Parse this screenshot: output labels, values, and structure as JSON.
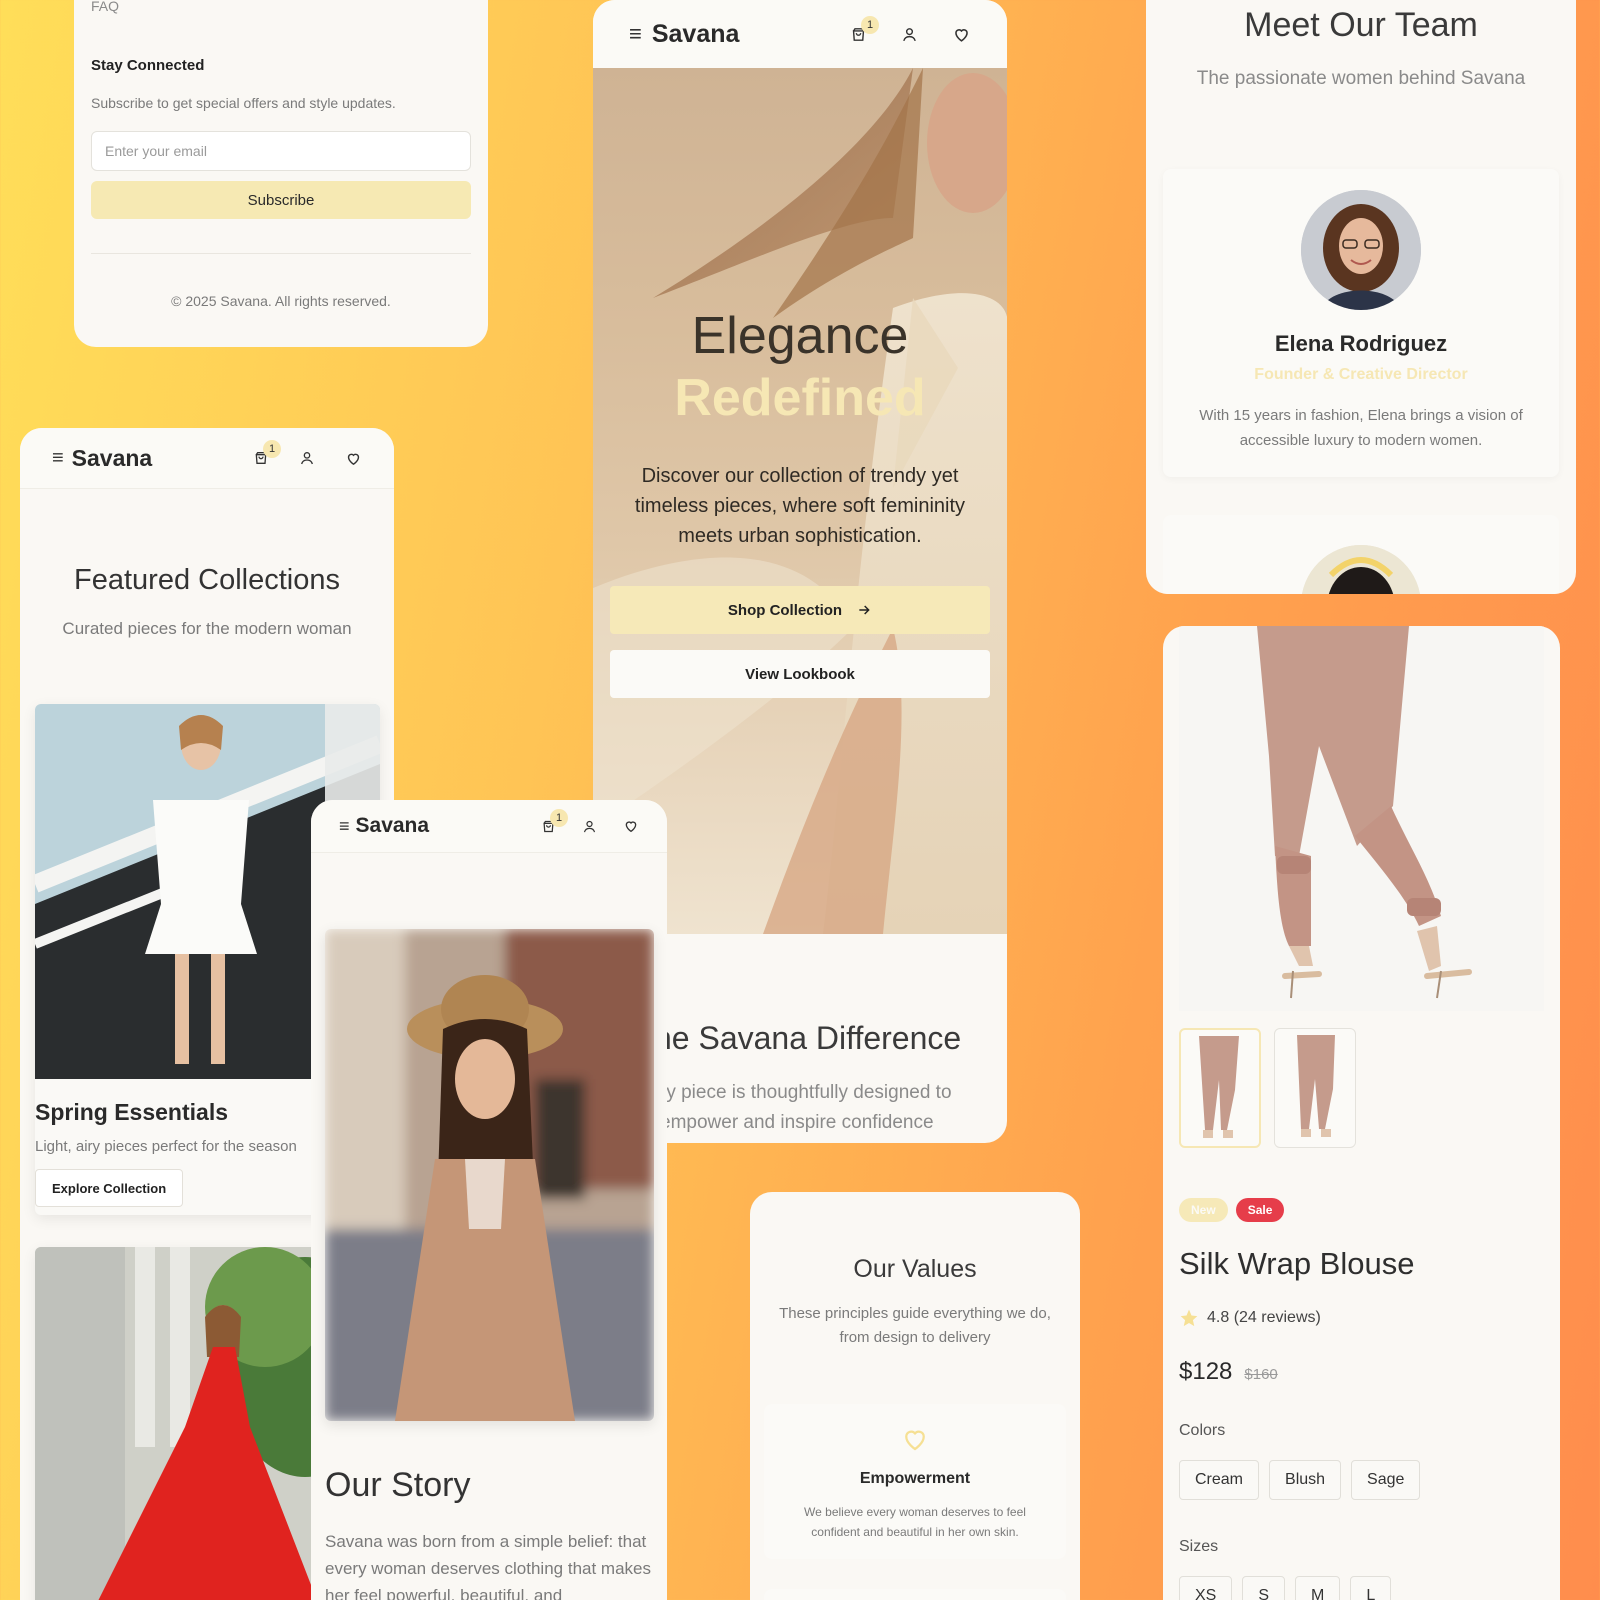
{
  "brand": "Savana",
  "cart_count": "1",
  "icons": {
    "menu": "menu-icon",
    "cart": "shopping-bag-icon",
    "user": "user-icon",
    "wishlist": "heart-icon",
    "arrow": "arrow-right-icon",
    "star": "star-icon",
    "value": "heart-outline-icon"
  },
  "colors": {
    "accent": "#f6e9b8",
    "sale": "#e63d4a",
    "background_from": "#ffde59",
    "background_to": "#ff8d4d"
  },
  "footer": {
    "faq": "FAQ",
    "stay_connected": "Stay Connected",
    "subscribe_text": "Subscribe to get special offers and style updates.",
    "email_placeholder": "Enter your email",
    "subscribe_button": "Subscribe",
    "copyright": "© 2025 Savana. All rights reserved."
  },
  "featured": {
    "title": "Featured Collections",
    "subtitle": "Curated pieces for the modern woman",
    "collections": [
      {
        "name": "Spring Essentials",
        "description": "Light, airy pieces perfect for the season",
        "button": "Explore Collection"
      }
    ]
  },
  "hero": {
    "title_line1": "Elegance",
    "title_line2": "Redefined",
    "description": "Discover our collection of trendy yet timeless pieces, where soft femininity meets urban sophistication.",
    "primary_button": "Shop Collection",
    "secondary_button": "View Lookbook",
    "difference_title": "he Savana Difference",
    "difference_line1": "ry piece is thoughtfully designed to",
    "difference_line2": "empower and inspire confidence"
  },
  "team": {
    "title": "Meet Our Team",
    "subtitle": "The passionate women behind Savana",
    "members": [
      {
        "name": "Elena Rodriguez",
        "role": "Founder & Creative Director",
        "bio": "With 15 years in fashion, Elena brings a vision of accessible luxury to modern women."
      }
    ]
  },
  "product": {
    "badges": {
      "new": "New",
      "sale": "Sale"
    },
    "name": "Silk Wrap Blouse",
    "rating": "4.8 (24 reviews)",
    "price": "$128",
    "original_price": "$160",
    "colors_label": "Colors",
    "colors": [
      "Cream",
      "Blush",
      "Sage"
    ],
    "sizes_label": "Sizes",
    "sizes": [
      "XS",
      "S",
      "M",
      "L"
    ]
  },
  "story": {
    "title": "Our Story",
    "text": "Savana was born from a simple belief: that every woman deserves clothing that makes her feel powerful, beautiful, and"
  },
  "values": {
    "title": "Our Values",
    "subtitle": "These principles guide everything we do, from design to delivery",
    "items": [
      {
        "name": "Empowerment",
        "description": "We believe every woman deserves to feel confident and beautiful in her own skin."
      }
    ]
  }
}
